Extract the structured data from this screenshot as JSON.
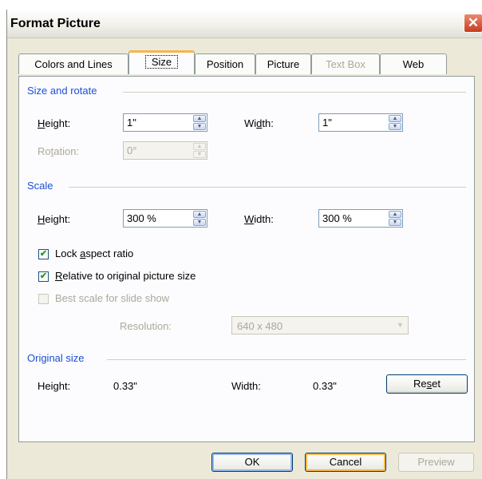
{
  "dialog": {
    "title": "Format Picture",
    "close_glyph": "✕"
  },
  "tabs": [
    {
      "label": "Colors and Lines",
      "state": "normal"
    },
    {
      "label": "Size",
      "state": "active"
    },
    {
      "label": "Position",
      "state": "normal"
    },
    {
      "label": "Picture",
      "state": "normal"
    },
    {
      "label": "Text Box",
      "state": "disabled"
    },
    {
      "label": "Web",
      "state": "normal"
    }
  ],
  "size_rotate": {
    "title": "Size and rotate",
    "height_label": "Height:",
    "height_value": "1\"",
    "width_label": "Width:",
    "width_value": "1\"",
    "rotation_label": "Rotation:",
    "rotation_value": "0°"
  },
  "scale": {
    "title": "Scale",
    "height_label": "Height:",
    "height_value": "300 %",
    "width_label": "Width:",
    "width_value": "300 %",
    "lock_aspect_label": "Lock aspect ratio",
    "lock_aspect_checked": true,
    "relative_label": "Relative to original picture size",
    "relative_checked": true,
    "best_scale_label": "Best scale for slide show",
    "best_scale_checked": false,
    "resolution_label": "Resolution:",
    "resolution_value": "640 x 480"
  },
  "original_size": {
    "title": "Original size",
    "height_label": "Height:",
    "height_value": "0.33\"",
    "width_label": "Width:",
    "width_value": "0.33\"",
    "reset_label": "Reset"
  },
  "footer": {
    "ok_label": "OK",
    "cancel_label": "Cancel",
    "preview_label": "Preview"
  },
  "icons": {
    "spin_up": "▲",
    "spin_down": "▼",
    "dropdown": "▼",
    "check": "✔"
  },
  "colors": {
    "group_title": "#1c4fd6",
    "active_tab_accent": "#f5b74b",
    "dialog_face": "#ece9d8",
    "disabled_text": "#aca899"
  }
}
